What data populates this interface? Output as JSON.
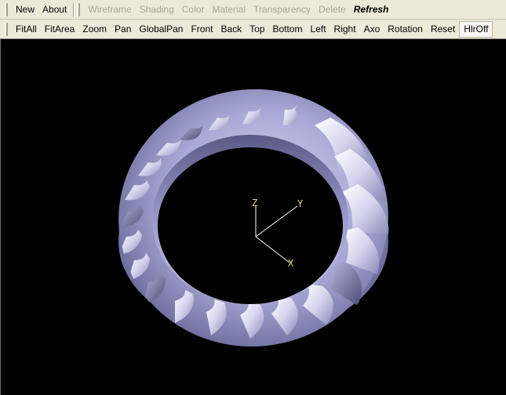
{
  "toolbar_top": {
    "buttons": [
      {
        "label": "New",
        "state": "enabled"
      },
      {
        "label": "About",
        "state": "enabled"
      },
      {
        "label": "Wireframe",
        "state": "disabled"
      },
      {
        "label": "Shading",
        "state": "disabled"
      },
      {
        "label": "Color",
        "state": "disabled"
      },
      {
        "label": "Material",
        "state": "disabled"
      },
      {
        "label": "Transparency",
        "state": "disabled"
      },
      {
        "label": "Delete",
        "state": "disabled"
      },
      {
        "label": "Refresh",
        "state": "bold"
      }
    ]
  },
  "toolbar_view": {
    "buttons": [
      {
        "label": "FitAll"
      },
      {
        "label": "FitArea"
      },
      {
        "label": "Zoom"
      },
      {
        "label": "Pan"
      },
      {
        "label": "GlobalPan"
      },
      {
        "label": "Front"
      },
      {
        "label": "Back"
      },
      {
        "label": "Top"
      },
      {
        "label": "Bottom"
      },
      {
        "label": "Left"
      },
      {
        "label": "Right"
      },
      {
        "label": "Axo"
      },
      {
        "label": "Rotation"
      },
      {
        "label": "Reset"
      },
      {
        "label": "HlrOff",
        "pressed": true
      }
    ]
  },
  "viewport": {
    "background": "#000000",
    "model": "turbine-rotor-ring",
    "model_color": "#a8a8d8",
    "trihedron": {
      "color": "#e8e060",
      "labels": {
        "z": "Z",
        "y": "Y",
        "x": "X"
      }
    }
  }
}
